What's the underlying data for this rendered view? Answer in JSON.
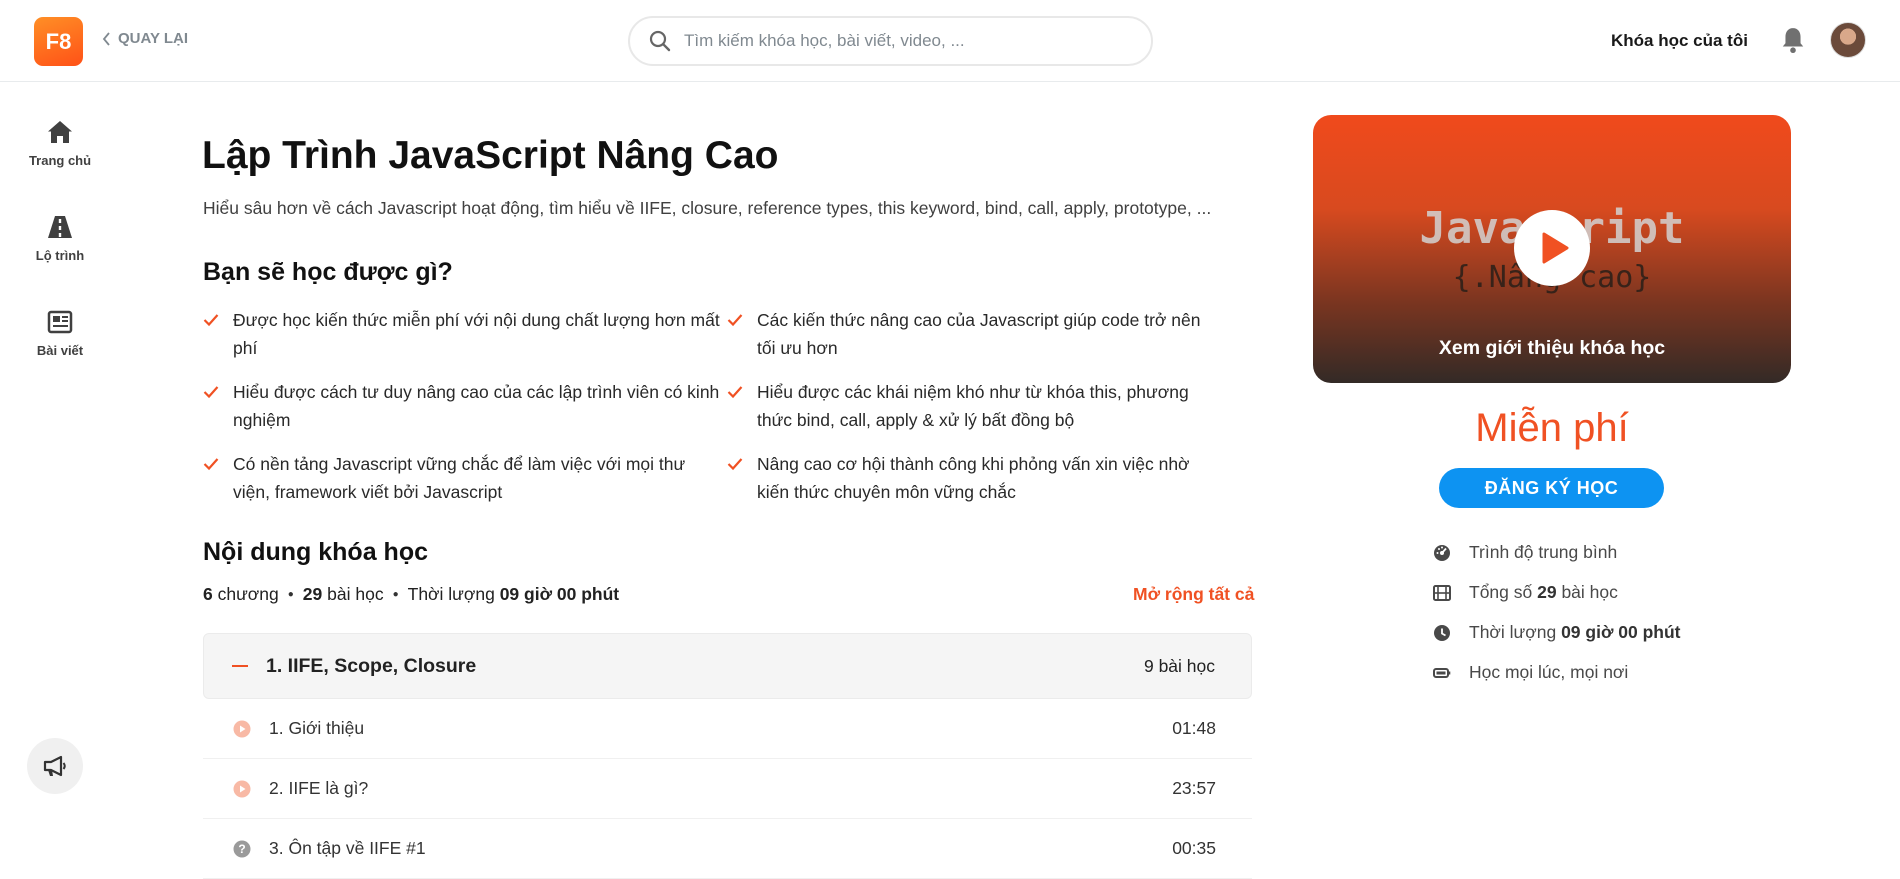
{
  "header": {
    "logo_text": "F8",
    "back_label": "QUAY LẠI",
    "search_placeholder": "Tìm kiếm khóa học, bài viết, video, ...",
    "my_courses_label": "Khóa học của tôi"
  },
  "sidebar": {
    "items": [
      {
        "label": "Trang chủ",
        "icon": "home-icon"
      },
      {
        "label": "Lộ trình",
        "icon": "road-icon"
      },
      {
        "label": "Bài viết",
        "icon": "newspaper-icon"
      }
    ]
  },
  "course": {
    "title": "Lập Trình JavaScript Nâng Cao",
    "description": "Hiểu sâu hơn về cách Javascript hoạt động, tìm hiểu về IIFE, closure, reference types, this keyword, bind, call, apply, prototype, ...",
    "learn_heading": "Bạn sẽ học được gì?",
    "learn_items": [
      "Được học kiến thức miễn phí với nội dung chất lượng hơn mất phí",
      "Các kiến thức nâng cao của Javascript giúp code trở nên tối ưu hơn",
      "Hiểu được cách tư duy nâng cao của các lập trình viên có kinh nghiệm",
      "Hiểu được các khái niệm khó như từ khóa this, phương thức bind, call, apply & xử lý bất đồng bộ",
      "Có nền tảng Javascript vững chắc để làm việc với mọi thư viện, framework viết bởi Javascript",
      "Nâng cao cơ hội thành công khi phỏng vấn xin việc nhờ kiến thức chuyên môn vững chắc"
    ],
    "content_heading": "Nội dung khóa học",
    "meta": {
      "chapters_count": "6",
      "chapters_label": "chương",
      "lessons_count": "29",
      "lessons_label": "bài học",
      "duration_label": "Thời lượng",
      "duration_value": "09 giờ 00 phút"
    },
    "expand_all_label": "Mở rộng tất cả",
    "chapter": {
      "title": "1. IIFE, Scope, Closure",
      "count": "9 bài học"
    },
    "lessons": [
      {
        "title": "1. Giới thiệu",
        "time": "01:48",
        "type": "video"
      },
      {
        "title": "2. IIFE là gì?",
        "time": "23:57",
        "type": "video"
      },
      {
        "title": "3. Ôn tập về IIFE #1",
        "time": "00:35",
        "type": "quiz"
      }
    ]
  },
  "preview": {
    "thumb_title": "Javascript",
    "thumb_subtitle": "{.Nâng cao}",
    "watch_label": "Xem giới thiệu khóa học"
  },
  "pricing": {
    "price": "Miễn phí",
    "register_label": "ĐĂNG KÝ HỌC"
  },
  "info": {
    "level": "Trình độ trung bình",
    "total_prefix": "Tổng số",
    "total_lessons": "29",
    "total_suffix": "bài học",
    "duration_prefix": "Thời lượng",
    "duration_value": "09 giờ 00 phút",
    "anywhere": "Học mọi lúc, mọi nơi"
  },
  "colors": {
    "accent": "#f05123",
    "button_blue": "#0d93f2"
  }
}
